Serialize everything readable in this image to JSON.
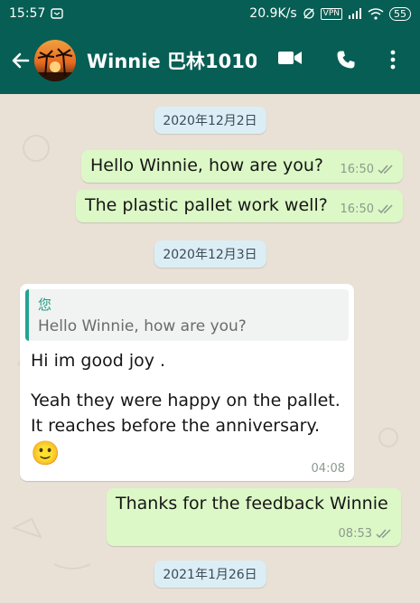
{
  "status_bar": {
    "time": "15:57",
    "network_speed": "20.9K/s",
    "vpn_label": "VPN",
    "battery": "55"
  },
  "header": {
    "contact_name": "Winnie 巴林1010...",
    "back_icon": "arrow-left-icon",
    "video_icon": "video-camera-icon",
    "call_icon": "phone-icon",
    "menu_icon": "more-vert-icon"
  },
  "chat": {
    "date_1": "2020年12月2日",
    "msg_1": {
      "text": "Hello Winnie, how are you?",
      "time": "16:50"
    },
    "msg_2": {
      "text": "The plastic pallet work well?",
      "time": "16:50"
    },
    "date_2": "2020年12月3日",
    "msg_3": {
      "quote_author": "您",
      "quote_text": "Hello Winnie, how are you?",
      "line_1": "Hi im good joy .",
      "line_2": "Yeah they were happy on the pallet.",
      "line_3": "It reaches before the anniversary.",
      "emoji": "🙂",
      "time": "04:08"
    },
    "msg_4": {
      "text": "Thanks for the feedback Winnie",
      "time": "08:53"
    },
    "date_3": "2021年1月26日"
  },
  "colors": {
    "header": "#075e54",
    "outgoing_bubble": "#dcf8c6",
    "incoming_bubble": "#ffffff",
    "date_chip": "#dbeef6",
    "quote_accent": "#25a38f"
  }
}
